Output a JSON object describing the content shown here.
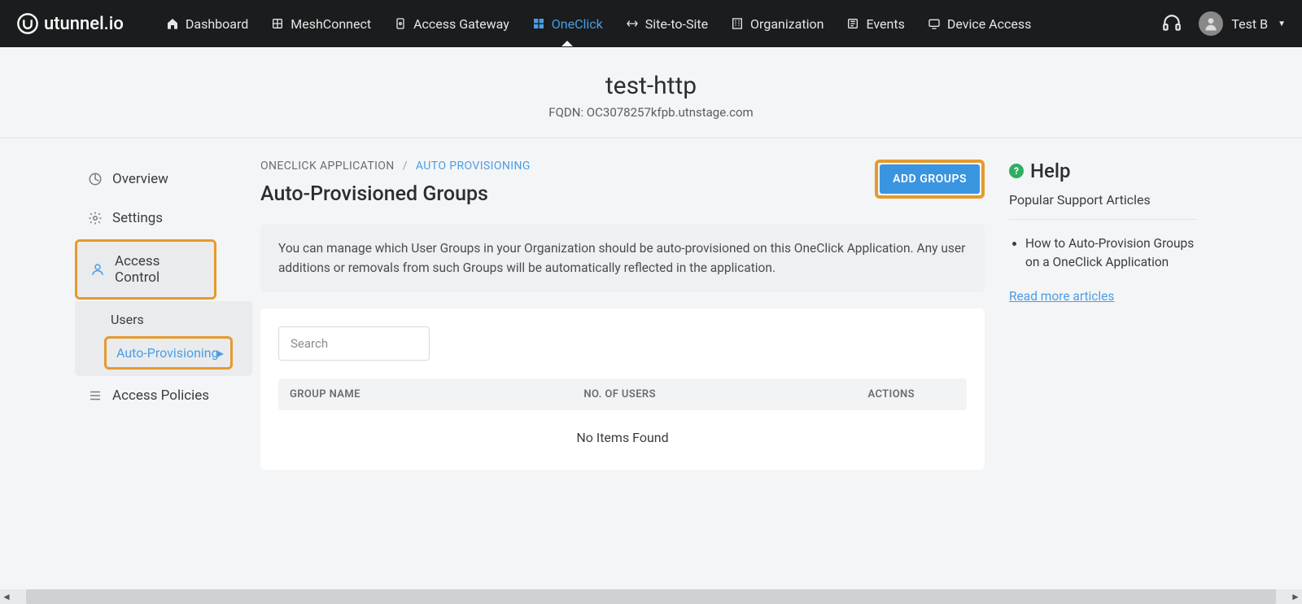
{
  "brand": "utunnel.io",
  "nav": {
    "items": [
      {
        "label": "Dashboard",
        "icon": "home"
      },
      {
        "label": "MeshConnect",
        "icon": "mesh"
      },
      {
        "label": "Access Gateway",
        "icon": "gateway"
      },
      {
        "label": "OneClick",
        "icon": "grid",
        "active": true
      },
      {
        "label": "Site-to-Site",
        "icon": "arrows"
      },
      {
        "label": "Organization",
        "icon": "org"
      },
      {
        "label": "Events",
        "icon": "events"
      },
      {
        "label": "Device Access",
        "icon": "device"
      }
    ],
    "user": "Test B"
  },
  "header": {
    "title": "test-http",
    "fqdn": "FQDN: OC3078257kfpb.utnstage.com"
  },
  "sidebar": {
    "overview": "Overview",
    "settings": "Settings",
    "access_control": "Access Control",
    "users": "Users",
    "auto_provisioning": "Auto-Provisioning",
    "access_policies": "Access Policies"
  },
  "breadcrumb": {
    "parent": "ONECLICK APPLICATION",
    "current": "AUTO PROVISIONING"
  },
  "main": {
    "section_title": "Auto-Provisioned Groups",
    "add_groups_btn": "ADD GROUPS",
    "info": "You can manage which User Groups in your Organization should be auto-provisioned on this OneClick Application. Any user additions or removals from such Groups will be automatically reflected in the application.",
    "search_placeholder": "Search",
    "columns": {
      "group": "GROUP NAME",
      "users": "NO. OF USERS",
      "actions": "ACTIONS"
    },
    "empty": "No Items Found"
  },
  "help": {
    "title": "Help",
    "subtitle": "Popular Support Articles",
    "article": "How to Auto-Provision Groups on a OneClick Application",
    "more": "Read more articles"
  }
}
